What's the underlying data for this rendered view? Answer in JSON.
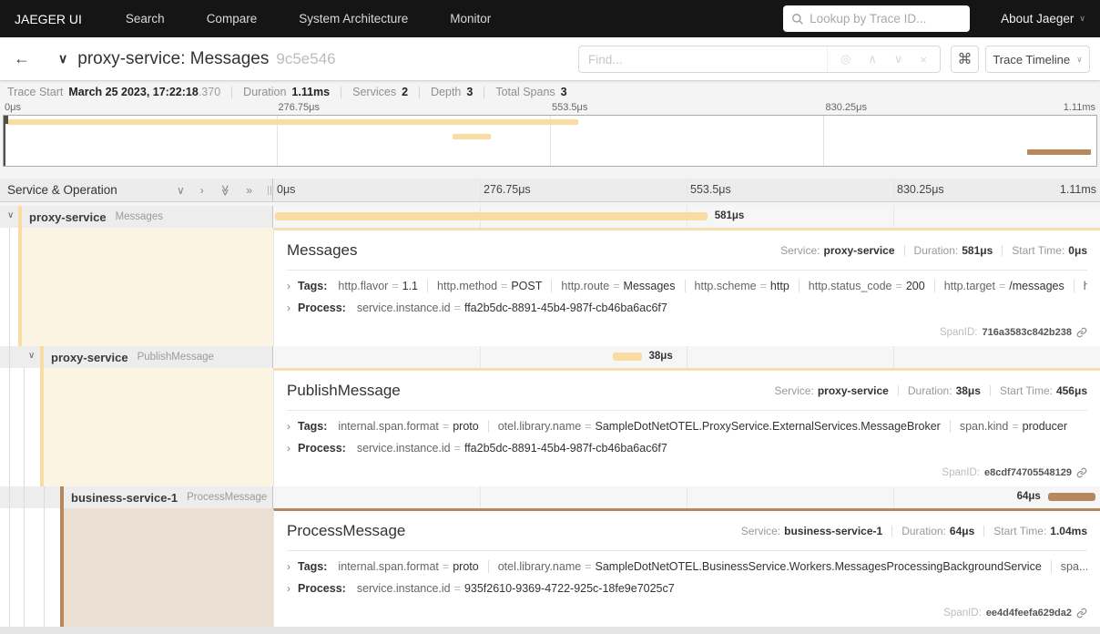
{
  "colors": {
    "nav_bg": "#151515",
    "proxy_service": "#F8DCA1",
    "business_service_1": "#B7885E"
  },
  "icons": {
    "search": "magnifier",
    "back": "←",
    "title_chevron": "∨",
    "caret_down": "∨",
    "find_target": "◎",
    "find_prev": "∧",
    "find_next": "∨",
    "find_clear": "×",
    "command": "⌘",
    "collapse_one": "∨",
    "expand_one": "›",
    "collapse_all": "≫",
    "expand_all": "»",
    "row_expand_caret": "›"
  },
  "nav": {
    "brand": "JAEGER UI",
    "items": [
      "Search",
      "Compare",
      "System Architecture",
      "Monitor"
    ],
    "lookup_placeholder": "Lookup by Trace ID...",
    "about": "About Jaeger"
  },
  "trace_bar": {
    "title": "proxy-service: Messages",
    "trace_id": "9c5e546",
    "find_placeholder": "Find...",
    "view_button": "Trace Timeline"
  },
  "summary": {
    "items": [
      {
        "label": "Trace Start",
        "value": "March 25 2023, 17:22:18",
        "suffix": ".370"
      },
      {
        "label": "Duration",
        "value": "1.11ms",
        "suffix": ""
      },
      {
        "label": "Services",
        "value": "2",
        "suffix": ""
      },
      {
        "label": "Depth",
        "value": "3",
        "suffix": ""
      },
      {
        "label": "Total Spans",
        "value": "3",
        "suffix": ""
      }
    ]
  },
  "timeline": {
    "left_header": "Service & Operation",
    "ticks": [
      "0μs",
      "276.75μs",
      "553.5μs",
      "830.25μs",
      "1.11ms"
    ]
  },
  "labels": {
    "service": "Service:",
    "duration": "Duration:",
    "start": "Start Time:",
    "tags": "Tags:",
    "process": "Process:",
    "spanid": "SpanID:"
  },
  "spans": [
    {
      "service": "proxy-service",
      "operation": "Messages",
      "duration": "581μs",
      "color": "#F8DCA1",
      "detail": {
        "title": "Messages",
        "service": "proxy-service",
        "duration": "581μs",
        "start": "0μs",
        "tags": [
          {
            "k": "http.flavor",
            "eq": "=",
            "v": "1.1"
          },
          {
            "k": "http.method",
            "eq": "=",
            "v": "POST"
          },
          {
            "k": "http.route",
            "eq": "=",
            "v": "Messages"
          },
          {
            "k": "http.scheme",
            "eq": "=",
            "v": "http"
          },
          {
            "k": "http.status_code",
            "eq": "=",
            "v": "200"
          },
          {
            "k": "http.target",
            "eq": "=",
            "v": "/messages"
          },
          {
            "k": "http....",
            "eq": "",
            "v": ""
          }
        ],
        "process": {
          "k": "service.instance.id",
          "eq": "=",
          "v": "ffa2b5dc-8891-45b4-987f-cb46ba6ac6f7"
        },
        "spanid": "716a3583c842b238"
      }
    },
    {
      "service": "proxy-service",
      "operation": "PublishMessage",
      "duration": "38μs",
      "color": "#F8DCA1",
      "detail": {
        "title": "PublishMessage",
        "service": "proxy-service",
        "duration": "38μs",
        "start": "456μs",
        "tags": [
          {
            "k": "internal.span.format",
            "eq": "=",
            "v": "proto"
          },
          {
            "k": "otel.library.name",
            "eq": "=",
            "v": "SampleDotNetOTEL.ProxyService.ExternalServices.MessageBroker"
          },
          {
            "k": "span.kind",
            "eq": "=",
            "v": "producer"
          }
        ],
        "process": {
          "k": "service.instance.id",
          "eq": "=",
          "v": "ffa2b5dc-8891-45b4-987f-cb46ba6ac6f7"
        },
        "spanid": "e8cdf74705548129"
      }
    },
    {
      "service": "business-service-1",
      "operation": "ProcessMessage",
      "duration": "64μs",
      "color": "#B7885E",
      "detail": {
        "title": "ProcessMessage",
        "service": "business-service-1",
        "duration": "64μs",
        "start": "1.04ms",
        "tags": [
          {
            "k": "internal.span.format",
            "eq": "=",
            "v": "proto"
          },
          {
            "k": "otel.library.name",
            "eq": "=",
            "v": "SampleDotNetOTEL.BusinessService.Workers.MessagesProcessingBackgroundService"
          },
          {
            "k": "spa...",
            "eq": "",
            "v": ""
          }
        ],
        "process": {
          "k": "service.instance.id",
          "eq": "=",
          "v": "935f2610-9369-4722-925c-18fe9e7025c7"
        },
        "spanid": "ee4d4feefa629da2"
      }
    }
  ]
}
